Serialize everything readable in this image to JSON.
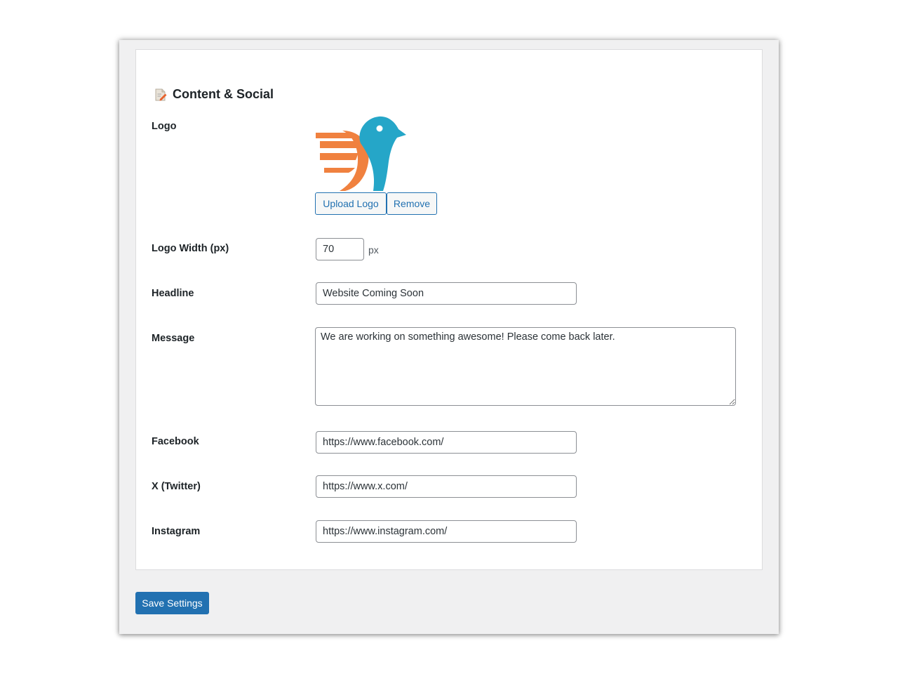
{
  "section": {
    "title": "Content & Social",
    "icon": "edit-page-icon"
  },
  "logo": {
    "label": "Logo",
    "upload_label": "Upload Logo",
    "remove_label": "Remove",
    "colors": {
      "orange": "#f0813f",
      "blue": "#25a6c8"
    }
  },
  "logo_width": {
    "label": "Logo Width (px)",
    "value": "70",
    "unit": "px"
  },
  "headline": {
    "label": "Headline",
    "value": "Website Coming Soon"
  },
  "message": {
    "label": "Message",
    "value": "We are working on something awesome! Please come back later."
  },
  "facebook": {
    "label": "Facebook",
    "value": "https://www.facebook.com/"
  },
  "twitter": {
    "label": "X (Twitter)",
    "value": "https://www.x.com/"
  },
  "instagram": {
    "label": "Instagram",
    "value": "https://www.instagram.com/"
  },
  "save_label": "Save Settings",
  "colors": {
    "primary": "#2271b1",
    "background": "#f0f0f1",
    "border": "#8c8f94"
  }
}
